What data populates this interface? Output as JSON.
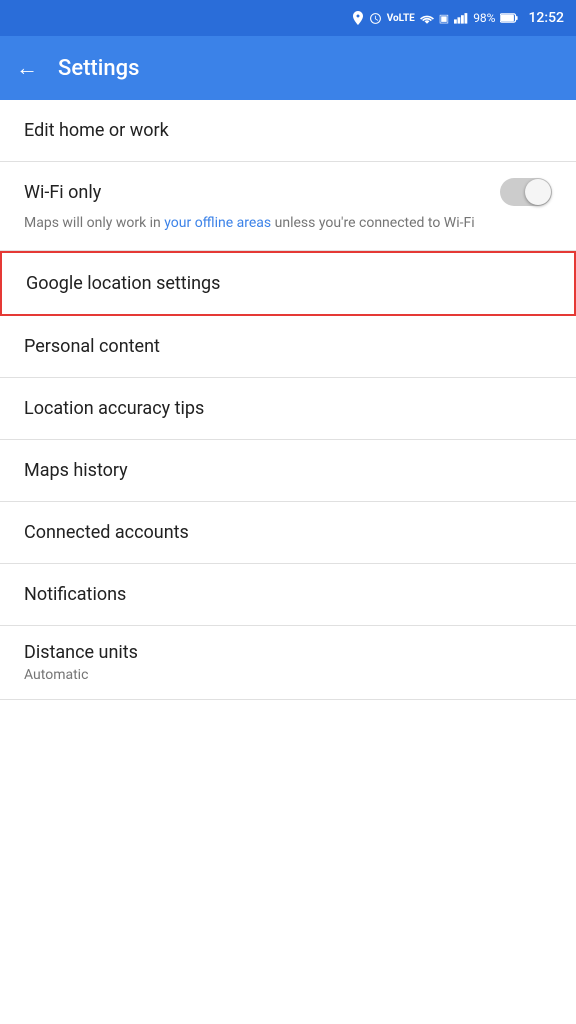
{
  "statusBar": {
    "time": "12:52",
    "battery": "98%",
    "icons": [
      "location",
      "alarm",
      "volte",
      "wifi",
      "sim1",
      "signal",
      "battery"
    ]
  },
  "appBar": {
    "title": "Settings",
    "backLabel": "←"
  },
  "settingsItems": [
    {
      "id": "edit-home-work",
      "label": "Edit home or work",
      "type": "nav"
    },
    {
      "id": "wifi-only",
      "label": "Wi-Fi only",
      "type": "toggle",
      "toggleOn": false,
      "description_prefix": "Maps will only work in ",
      "description_link": "your offline areas",
      "description_suffix": " unless you're connected to Wi-Fi"
    },
    {
      "id": "google-location-settings",
      "label": "Google location settings",
      "type": "nav",
      "highlighted": true
    },
    {
      "id": "personal-content",
      "label": "Personal content",
      "type": "nav"
    },
    {
      "id": "location-accuracy-tips",
      "label": "Location accuracy tips",
      "type": "nav"
    },
    {
      "id": "maps-history",
      "label": "Maps history",
      "type": "nav"
    },
    {
      "id": "connected-accounts",
      "label": "Connected accounts",
      "type": "nav"
    },
    {
      "id": "notifications",
      "label": "Notifications",
      "type": "nav"
    },
    {
      "id": "distance-units",
      "label": "Distance units",
      "sublabel": "Automatic",
      "type": "nav-sub"
    }
  ],
  "colors": {
    "appBarBg": "#3b82e8",
    "statusBarBg": "#2a6dd9",
    "highlightBorder": "#e53935",
    "linkColor": "#3b82e8"
  }
}
